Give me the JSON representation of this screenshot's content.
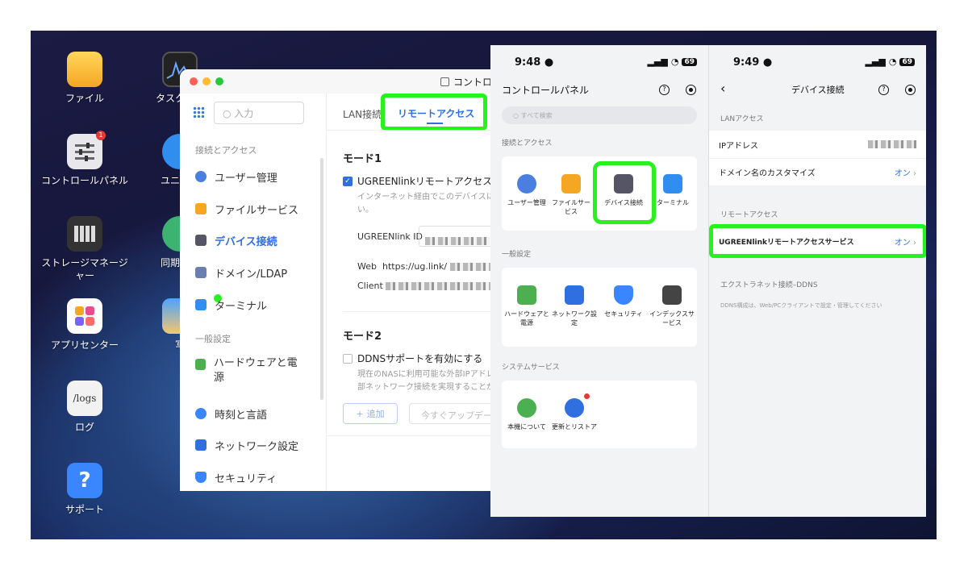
{
  "desktop": {
    "icons": [
      {
        "label": "ファイル"
      },
      {
        "label": "タスクマネ"
      },
      {
        "label": "コントロールパネル"
      },
      {
        "label": "ユニバー"
      },
      {
        "label": "ストレージマネージャー"
      },
      {
        "label": "同期とバ"
      },
      {
        "label": "アプリセンター"
      },
      {
        "label": "写"
      },
      {
        "label": "ログ"
      },
      {
        "label": "サポート"
      }
    ],
    "log_icon_text": "/logs"
  },
  "control_panel": {
    "title": "コントロ",
    "search_placeholder": "入力",
    "sidebar": {
      "section1": "接続とアクセス",
      "items1": [
        "ユーザー管理",
        "ファイルサービス",
        "デバイス接続",
        "ドメイン/LDAP",
        "ターミナル"
      ],
      "section2": "一般設定",
      "items2": [
        "ハードウェアと電源",
        "時刻と言語",
        "ネットワーク設定",
        "セキュリティ"
      ]
    },
    "tabs": {
      "lan": "LAN接続",
      "remote": "リモートアクセス"
    },
    "mode1": {
      "heading": "モード1",
      "checkbox_label": "UGREENlinkリモートアクセスサ",
      "desc": "インターネット経由でこのデバイスにい。",
      "id_label": "UGREENlink ID",
      "web_label": "Web",
      "web_value": "https://ug.link/",
      "client_label": "Client"
    },
    "mode2": {
      "heading": "モード2",
      "checkbox_label": "DDNSサポートを有効にする",
      "desc": "現在のNASに利用可能な外部IPアドレ部ネットワーク接続を実現することが",
      "add_button": "追加",
      "update_button": "今すぐアップデー"
    }
  },
  "phone1": {
    "time": "9:48",
    "battery": "69",
    "title": "コントロールパネル",
    "search_placeholder": "すべて検索",
    "section1": "接続とアクセス",
    "grid1": [
      "ユーザー管理",
      "ファイルサービス",
      "デバイス接続",
      "ターミナル"
    ],
    "section2": "一般設定",
    "grid2": [
      "ハードウェアと電源",
      "ネットワーク設定",
      "セキュリティ",
      "インデックスサービス"
    ],
    "section3": "システムサービス",
    "grid3": [
      "本機について",
      "更新とリストア"
    ]
  },
  "phone2": {
    "time": "9:49",
    "battery": "69",
    "title": "デバイス接続",
    "lan_section": "LANアクセス",
    "ip_label": "IPアドレス",
    "domain_label": "ドメイン名のカスタマイズ",
    "domain_value": "オン",
    "remote_section": "リモートアクセス",
    "ugreen_label": "UGREENlinkリモートアクセスサービス",
    "ugreen_value": "オン",
    "extranet_section": "エクストラネット接続–DDNS",
    "ddns_desc": "DDNS構成は、Web/PCクライアントで設定・管理してください"
  },
  "colors": {
    "highlight": "#27f21d",
    "accent": "#2f6fe0"
  }
}
